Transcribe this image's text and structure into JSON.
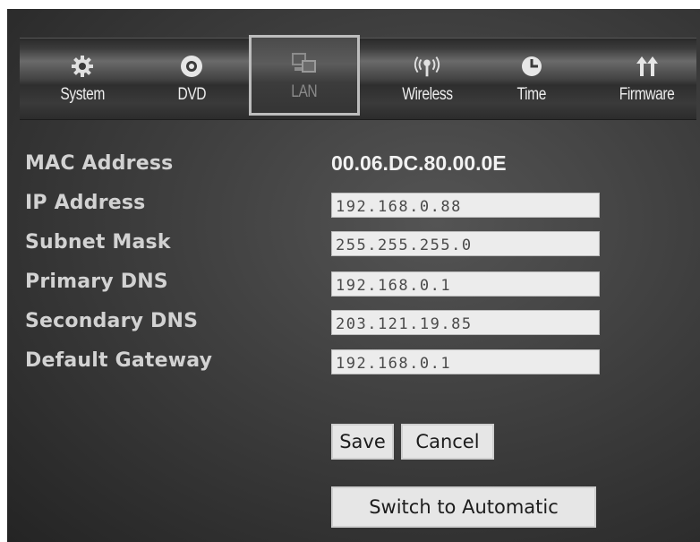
{
  "tabs": [
    {
      "label": "System",
      "icon": "gear-icon"
    },
    {
      "label": "DVD",
      "icon": "disc-icon"
    },
    {
      "label": "LAN",
      "icon": "lan-computers-icon",
      "selected": true
    },
    {
      "label": "Wireless",
      "icon": "wireless-antenna-icon"
    },
    {
      "label": "Time",
      "icon": "clock-icon"
    },
    {
      "label": "Firmware",
      "icon": "upgrade-arrows-icon"
    }
  ],
  "lan": {
    "mac_label": "MAC Address",
    "mac_value": "00.06.DC.80.00.0E",
    "ip_label": "IP Address",
    "ip_value": "192.168.0.88",
    "subnet_label": "Subnet Mask",
    "subnet_value": "255.255.255.0",
    "primary_dns_label": "Primary DNS",
    "primary_dns_value": "192.168.0.1",
    "secondary_dns_label": "Secondary DNS",
    "secondary_dns_value": "203.121.19.85",
    "gateway_label": "Default Gateway",
    "gateway_value": "192.168.0.1"
  },
  "buttons": {
    "save": "Save",
    "cancel": "Cancel",
    "switch_auto": "Switch to Automatic"
  }
}
